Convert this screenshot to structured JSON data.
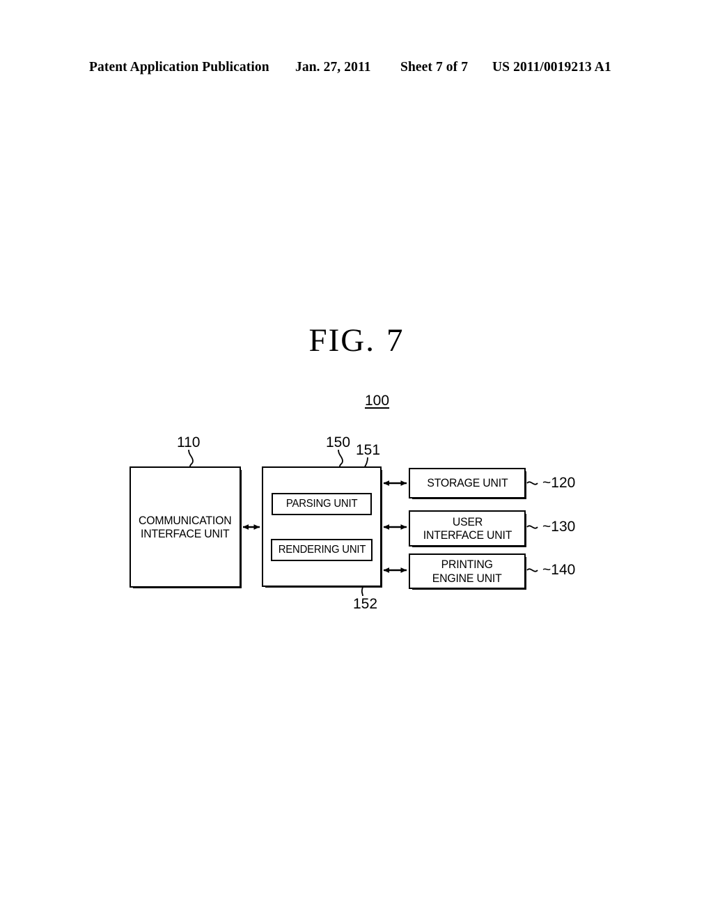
{
  "header": {
    "publication": "Patent Application Publication",
    "date": "Jan. 27, 2011",
    "sheet": "Sheet 7 of 7",
    "patent_number": "US 2011/0019213 A1"
  },
  "figure": {
    "label": "FIG.",
    "number": "7",
    "system_ref": "100"
  },
  "blocks": [
    {
      "id": "comm",
      "line1": "COMMUNICATION",
      "line2": "INTERFACE UNIT",
      "ref": "110"
    },
    {
      "id": "control",
      "line1": "",
      "line2": "",
      "ref": "150"
    },
    {
      "id": "parsing",
      "line1": "PARSING UNIT",
      "line2": "",
      "ref": "151"
    },
    {
      "id": "rendering",
      "line1": "RENDERING UNIT",
      "line2": "",
      "ref": "152"
    },
    {
      "id": "storage",
      "line1": "STORAGE UNIT",
      "line2": "",
      "ref": "120"
    },
    {
      "id": "userif",
      "line1": "USER",
      "line2": "INTERFACE UNIT",
      "ref": "130"
    },
    {
      "id": "printing",
      "line1": "PRINTING",
      "line2": "ENGINE UNIT",
      "ref": "140"
    }
  ],
  "refs": {
    "system": "100",
    "comm": "110",
    "storage": "~120",
    "userif": "~130",
    "printing": "~140",
    "control": "150",
    "parsing": "151",
    "rendering": "152"
  },
  "connections": [
    {
      "from": "comm",
      "to": "control",
      "style": "double-arrow"
    },
    {
      "from": "control",
      "to": "storage",
      "style": "double-arrow"
    },
    {
      "from": "control",
      "to": "userif",
      "style": "double-arrow"
    },
    {
      "from": "control",
      "to": "printing",
      "style": "double-arrow"
    }
  ],
  "colors": {
    "ink": "#000000",
    "paper": "#ffffff"
  }
}
